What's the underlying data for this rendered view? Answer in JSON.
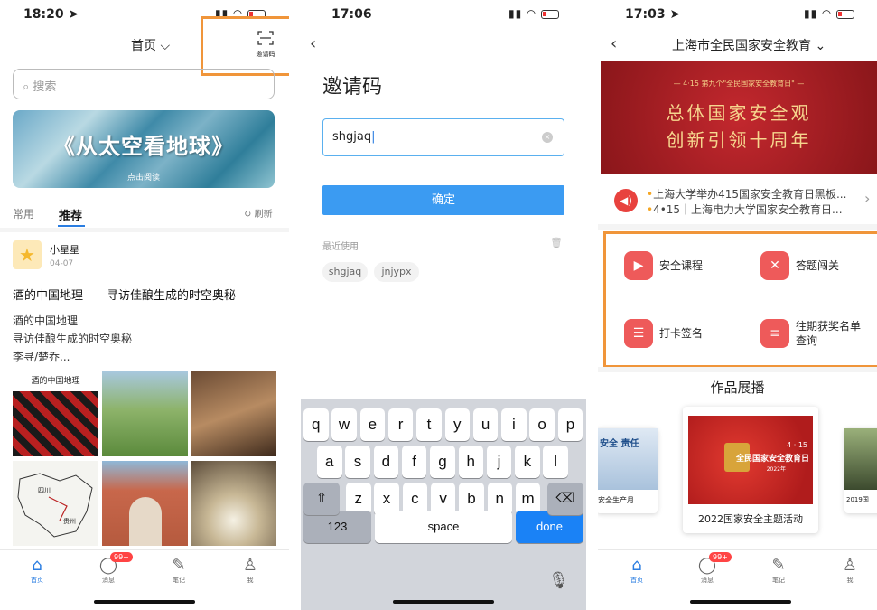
{
  "screen1": {
    "status": {
      "time": "18:20 ➤"
    },
    "header": {
      "title": "首页 ⌵",
      "scan_label": "邀请码"
    },
    "search": {
      "placeholder": "搜索"
    },
    "banner": {
      "title": "《从太空看地球》",
      "sub": "点击阅读"
    },
    "tabs": [
      {
        "label": "常用"
      },
      {
        "label": "推荐"
      }
    ],
    "refresh_label": "刷新",
    "post": {
      "author": "小星星",
      "date": "04-07",
      "title": "酒的中国地理——寻访佳酿生成的时空奥秘",
      "lines": [
        "酒的中国地理",
        "寻访佳酿生成的时空奥秘",
        "李寻/楚乔..."
      ],
      "book_cover_text": "酒的中国地理",
      "map_labels": [
        "四川",
        "贵州"
      ]
    },
    "tabbar": [
      {
        "label": "首页",
        "icon": "home-icon"
      },
      {
        "label": "消息",
        "icon": "message-icon",
        "badge": "99+"
      },
      {
        "label": "笔记",
        "icon": "note-icon"
      },
      {
        "label": "我",
        "icon": "user-icon"
      }
    ]
  },
  "screen2": {
    "status": {
      "time": "17:06"
    },
    "title": "邀请码",
    "input": {
      "value": "shgjaq"
    },
    "confirm_label": "确定",
    "recent_label": "最近使用",
    "recent": [
      "shgjaq",
      "jnjypx"
    ],
    "keyboard": {
      "row1": [
        "q",
        "w",
        "e",
        "r",
        "t",
        "y",
        "u",
        "i",
        "o",
        "p"
      ],
      "row2": [
        "a",
        "s",
        "d",
        "f",
        "g",
        "h",
        "j",
        "k",
        "l"
      ],
      "row3": [
        "z",
        "x",
        "c",
        "v",
        "b",
        "n",
        "m"
      ],
      "num": "123",
      "space": "space",
      "done": "done"
    }
  },
  "screen3": {
    "status": {
      "time": "17:03 ➤"
    },
    "header": {
      "title": "上海市全民国家安全教育 ⌄"
    },
    "banner": {
      "top": "— 4·15 第九个\"全民国家安全教育日\" —",
      "line1": "总体国家安全观",
      "line2": "创新引领十周年"
    },
    "news": [
      "上海大学举办415国家安全教育日黑板...",
      "4•15｜上海电力大学国家安全教育日..."
    ],
    "features": [
      {
        "label": "安全课程",
        "icon": "play-icon"
      },
      {
        "label": "答题闯关",
        "icon": "swords-icon"
      },
      {
        "label": "打卡签名",
        "icon": "document-icon"
      },
      {
        "label": "往期获奖名单查询",
        "icon": "list-icon"
      }
    ],
    "showcase": {
      "title": "作品展播",
      "center": {
        "title": "2022国家安全主题活动",
        "poster_top": "4 · 15",
        "poster_main": "全民国家安全教育日",
        "poster_year": "2022年"
      },
      "left": {
        "title": "安全生产月",
        "poster_text": "安全 责任"
      },
      "right": {
        "title": "2019国"
      }
    },
    "tabbar": [
      {
        "label": "首页"
      },
      {
        "label": "消息",
        "badge": "99+"
      },
      {
        "label": "笔记"
      },
      {
        "label": "我"
      }
    ]
  },
  "colors": {
    "accent": "#2a7de1",
    "highlight": "#f0953a",
    "red": "#c3282e",
    "button": "#3b9bf2"
  }
}
